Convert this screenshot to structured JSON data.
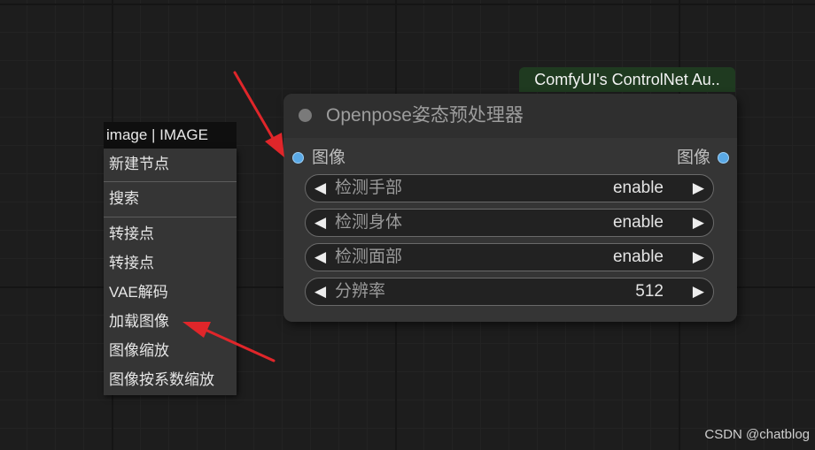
{
  "context_menu": {
    "title": "image | IMAGE",
    "items": [
      "新建节点",
      "搜索",
      "转接点",
      "转接点",
      "VAE解码",
      "加载图像",
      "图像缩放",
      "图像按系数缩放"
    ]
  },
  "group": {
    "label": "ComfyUI's ControlNet Au.."
  },
  "node": {
    "title": "Openpose姿态预处理器",
    "input_label": "图像",
    "output_label": "图像",
    "widgets": [
      {
        "label": "检测手部",
        "value": "enable"
      },
      {
        "label": "检测身体",
        "value": "enable"
      },
      {
        "label": "检测面部",
        "value": "enable"
      },
      {
        "label": "分辨率",
        "value": "512"
      }
    ],
    "arrow_left": "◀",
    "arrow_right": "▶"
  },
  "watermark": "CSDN @chatblog",
  "colors": {
    "canvas": "#1d1d1d",
    "node_body": "#353535",
    "group_tag": "#1f3a20",
    "port": "#5aa9e6",
    "annotation_arrow": "#e0262a"
  }
}
